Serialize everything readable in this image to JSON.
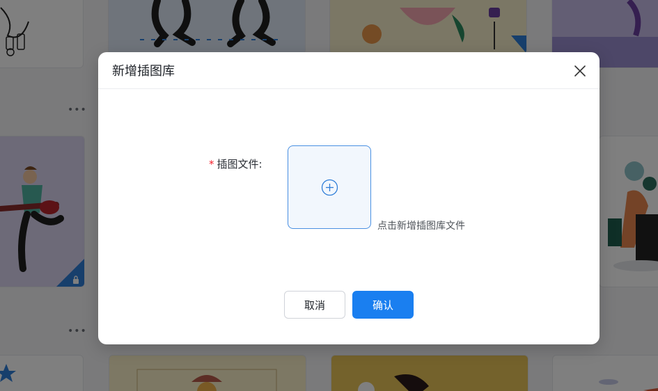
{
  "modal": {
    "title": "新增插图库",
    "field_label": "插图文件:",
    "required_mark": "*",
    "upload_hint": "点击新增插图库文件",
    "cancel_label": "取消",
    "confirm_label": "确认"
  },
  "gallery": {
    "more_dots": "•••"
  },
  "colors": {
    "primary": "#1a7ff0",
    "required": "#f5222d",
    "overlay": "rgba(0,0,0,0.5)",
    "lock_corner": "#2f7ed8"
  },
  "icons": {
    "close": "close-icon",
    "upload": "plus-circle-icon",
    "lock": "lock-icon",
    "more": "more-dots-icon"
  }
}
